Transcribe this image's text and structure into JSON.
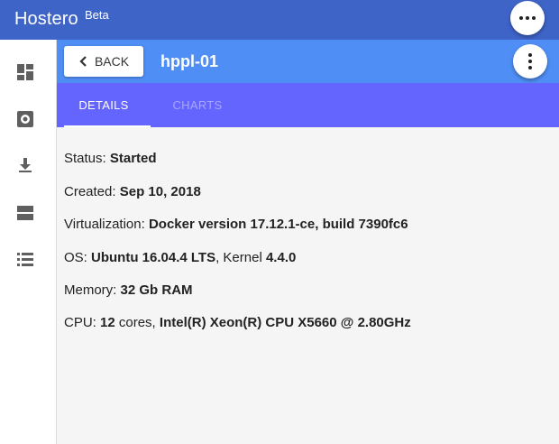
{
  "app": {
    "title": "Hostero",
    "badge": "Beta"
  },
  "header": {
    "back_label": "BACK",
    "host_name": "hppl-01"
  },
  "tabs": [
    {
      "label": "DETAILS",
      "active": true
    },
    {
      "label": "CHARTS",
      "active": false
    }
  ],
  "sidebar": {
    "icons": [
      "dashboard-icon",
      "settings-icon",
      "download-icon",
      "server-icon",
      "list-icon"
    ]
  },
  "details": {
    "status": {
      "label": "Status:",
      "value": "Started"
    },
    "created": {
      "label": "Created:",
      "value": "Sep 10, 2018"
    },
    "virtualization": {
      "label": "Virtualization:",
      "value": "Docker version 17.12.1-ce, build 7390fc6"
    },
    "os": {
      "label": "OS:",
      "value": "Ubuntu 16.04.4 LTS",
      "sep": ", Kernel",
      "kernel": "4.4.0"
    },
    "memory": {
      "label": "Memory:",
      "value": "32 Gb RAM"
    },
    "cpu": {
      "label": "CPU:",
      "cores": "12",
      "cores_suffix": "cores,",
      "model": "Intel(R) Xeon(R) CPU X5660 @ 2.80GHz"
    }
  },
  "colors": {
    "topbar": "#3f64c8",
    "header": "#4f8ff5",
    "tabs": "#6464ff",
    "content_bg": "#f5f5f5"
  }
}
